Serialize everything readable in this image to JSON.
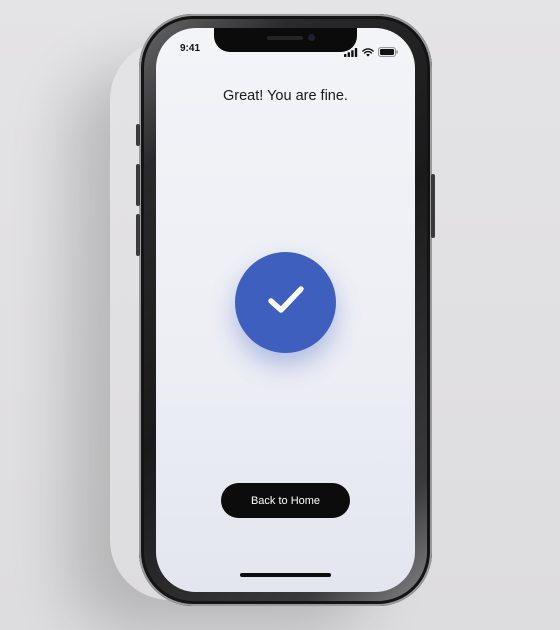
{
  "status_bar": {
    "time": "9:41",
    "icons": [
      "signal-icon",
      "wifi-icon",
      "battery-icon"
    ]
  },
  "result": {
    "title": "Great! You are fine.",
    "icon": "checkmark-icon",
    "accent_color": "#3f5fbf"
  },
  "actions": {
    "back_home_label": "Back to Home"
  }
}
